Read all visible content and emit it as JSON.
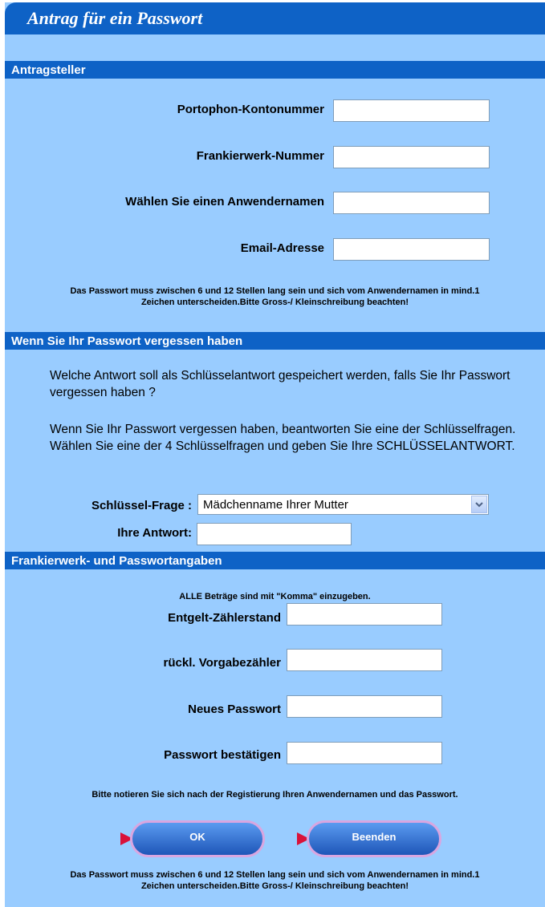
{
  "title": "Antrag für ein Passwort",
  "sections": {
    "applicant": "Antragsteller",
    "forgot": "Wenn Sie Ihr Passwort vergessen haben",
    "meter": "Frankierwerk- und Passwortangaben"
  },
  "applicant": {
    "account_label": "Portophon-Kontonummer",
    "machine_label": "Frankierwerk-Nummer",
    "username_label": "Wählen Sie einen Anwendernamen",
    "email_label": "Email-Adresse",
    "note_line1": "Das Passwort muss zwischen 6 und 12 Stellen lang sein und sich vom Anwendernamen in mind.1",
    "note_line2": "Zeichen unterscheiden.Bitte Gross-/ Kleinschreibung beachten!"
  },
  "forgot": {
    "para1": "Welche Antwort soll als Schlüsselantwort gespeichert werden, falls Sie Ihr Passwort vergessen haben ?",
    "para2": "Wenn Sie Ihr Passwort vergessen haben, beantworten Sie eine der Schlüsselfragen. Wählen Sie eine der 4 Schlüsselfragen und geben Sie Ihre SCHLÜSSELANTWORT.",
    "question_label": "Schlüssel-Frage :",
    "question_value": "Mädchenname Ihrer Mutter",
    "answer_label": "Ihre Antwort:"
  },
  "meter": {
    "comma_note": "ALLE Beträge sind mit \"Komma\" einzugeben.",
    "counter_label": "Entgelt-Zählerstand",
    "preset_label": "rückl. Vorgabezähler",
    "new_pw_label": "Neues Passwort",
    "confirm_pw_label": "Passwort bestätigen",
    "remember_note": "Bitte notieren Sie sich nach der Registierung Ihren Anwendernamen und das Passwort.",
    "note_line1": "Das Passwort muss zwischen 6 und 12 Stellen lang sein und sich vom Anwendernamen in mind.1",
    "note_line2": "Zeichen unterscheiden.Bitte Gross-/ Kleinschreibung beachten!"
  },
  "buttons": {
    "ok": "OK",
    "exit": "Beenden"
  },
  "colors": {
    "header_blue": "#0e62c6",
    "panel_blue": "#99ccff",
    "arrow_red": "#d9123a"
  },
  "icons": {
    "dropdown": "chevron-down-icon",
    "button_marker": "triangle-right-icon"
  }
}
